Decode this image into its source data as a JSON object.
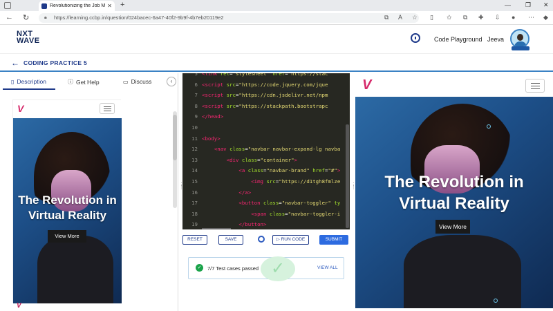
{
  "browser": {
    "tab_title": "Revolutionizing the Job Market |",
    "url": "https://learning.ccbp.in/question/024bacec-6a47-40f2-9b9f-4b7eb20119e2"
  },
  "header": {
    "logo_line1": "NXT",
    "logo_line2": "WAVE",
    "code_playground": "Code Playground",
    "user_name": "Jeeva"
  },
  "practice": {
    "title": "CODING PRACTICE 5"
  },
  "left_tabs": [
    {
      "label": "Description",
      "icon": "document-icon"
    },
    {
      "label": "Get Help",
      "icon": "help-circle-icon"
    },
    {
      "label": "Discuss",
      "icon": "chat-icon"
    }
  ],
  "preview": {
    "hero_title": "The Revolution in Virtual Reality",
    "button_label": "View More"
  },
  "editor": {
    "lines": [
      {
        "n": "5",
        "html": "<span class='tg'>&lt;link</span> <span class='at'>rel</span>=<span class='st'>\"stylesheet\"</span> <span class='at'>href</span>=<span class='st'>\"https://stac</span>"
      },
      {
        "n": "6",
        "html": "<span class='tg'>&lt;script</span> <span class='at'>src</span>=<span class='st'>\"https://code.jquery.com/jque</span>"
      },
      {
        "n": "7",
        "html": "<span class='tg'>&lt;script</span> <span class='at'>src</span>=<span class='st'>\"https://cdn.jsdelivr.net/npm</span>"
      },
      {
        "n": "8",
        "html": "<span class='tg'>&lt;script</span> <span class='at'>src</span>=<span class='st'>\"https://stackpath.bootstrapc</span>"
      },
      {
        "n": "9",
        "html": "<span class='tg'>&lt;/head&gt;</span>"
      },
      {
        "n": "10",
        "html": ""
      },
      {
        "n": "11",
        "html": "<span class='tg'>&lt;body&gt;</span>"
      },
      {
        "n": "12",
        "html": "    <span class='tg'>&lt;nav</span> <span class='at'>class</span>=<span class='st'>\"navbar navbar-expand-lg navba</span>"
      },
      {
        "n": "13",
        "html": "        <span class='tg'>&lt;div</span> <span class='at'>class</span>=<span class='st'>\"container\"</span><span class='tg'>&gt;</span>"
      },
      {
        "n": "14",
        "html": "            <span class='tg'>&lt;a</span> <span class='at'>class</span>=<span class='st'>\"navbar-brand\"</span> <span class='at'>href</span>=<span class='st'>\"#\"</span><span class='tg'>&gt;</span>"
      },
      {
        "n": "15",
        "html": "                <span class='tg'>&lt;img</span> <span class='at'>src</span>=<span class='st'>\"https://d1tgh8fmlze</span>"
      },
      {
        "n": "16",
        "html": "            <span class='tg'>&lt;/a&gt;</span>"
      },
      {
        "n": "17",
        "html": "            <span class='tg'>&lt;button</span> <span class='at'>class</span>=<span class='st'>\"navbar-toggler\"</span> <span class='at'>ty</span>"
      },
      {
        "n": "18",
        "html": "                <span class='tg'>&lt;span</span> <span class='at'>class</span>=<span class='st'>\"navbar-toggler-i</span>"
      },
      {
        "n": "19",
        "html": "            <span class='tg'>&lt;/button&gt;</span>"
      }
    ]
  },
  "controls": {
    "reset": "RESET",
    "save": "SAVE",
    "run": "RUN CODE",
    "submit": "SUBMIT"
  },
  "result": {
    "text": "7/7 Test cases passed",
    "view_all": "VIEW ALL"
  }
}
